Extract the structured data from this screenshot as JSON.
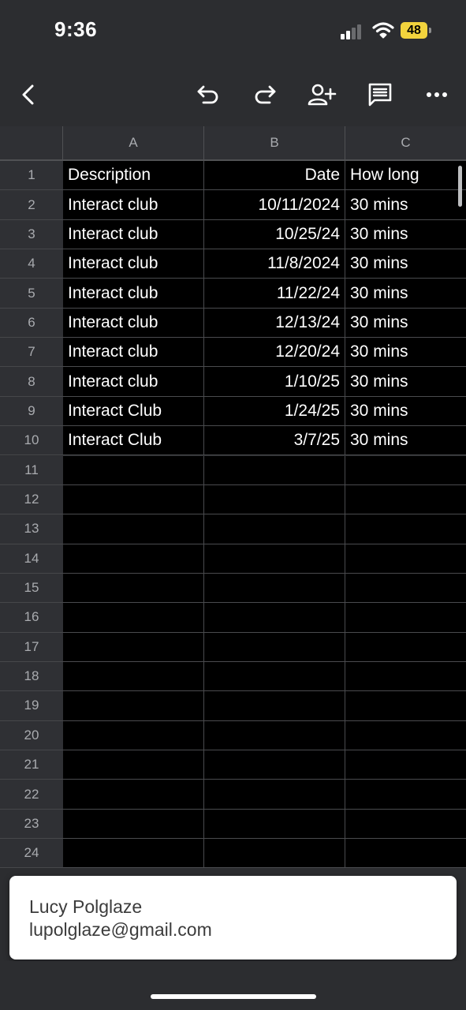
{
  "status": {
    "time": "9:36",
    "battery": "48",
    "battery_color": "#f2d33d"
  },
  "toolbar": {
    "icons": [
      "back-icon",
      "undo-icon",
      "redo-icon",
      "add-person-icon",
      "comment-icon",
      "more-icon"
    ]
  },
  "sheet": {
    "columns": [
      "A",
      "B",
      "C"
    ],
    "rows": [
      [
        "1",
        "Description",
        "Date",
        "How long"
      ],
      [
        "2",
        "Interact club",
        "10/11/2024",
        "30 mins"
      ],
      [
        "3",
        "Interact club",
        "10/25/24",
        "30 mins"
      ],
      [
        "4",
        "Interact club",
        "11/8/2024",
        "30 mins"
      ],
      [
        "5",
        "Interact club",
        "11/22/24",
        "30 mins"
      ],
      [
        "6",
        "Interact club",
        "12/13/24",
        "30 mins"
      ],
      [
        "7",
        "Interact club",
        "12/20/24",
        "30 mins"
      ],
      [
        "8",
        "Interact club",
        "1/10/25",
        "30 mins"
      ],
      [
        "9",
        "Interact Club",
        "1/24/25",
        "30 mins"
      ],
      [
        "10",
        "Interact Club",
        "3/7/25",
        "30 mins"
      ],
      [
        "11",
        "",
        "",
        ""
      ],
      [
        "12",
        "",
        "",
        ""
      ],
      [
        "13",
        "",
        "",
        ""
      ],
      [
        "14",
        "",
        "",
        ""
      ],
      [
        "15",
        "",
        "",
        ""
      ],
      [
        "16",
        "",
        "",
        ""
      ],
      [
        "17",
        "",
        "",
        ""
      ],
      [
        "18",
        "",
        "",
        ""
      ],
      [
        "19",
        "",
        "",
        ""
      ],
      [
        "20",
        "",
        "",
        ""
      ],
      [
        "21",
        "",
        "",
        ""
      ],
      [
        "22",
        "",
        "",
        ""
      ],
      [
        "23",
        "",
        "",
        ""
      ],
      [
        "24",
        "",
        "",
        ""
      ]
    ]
  },
  "account": {
    "name": "Lucy Polglaze",
    "email": "lupolglaze@gmail.com"
  }
}
